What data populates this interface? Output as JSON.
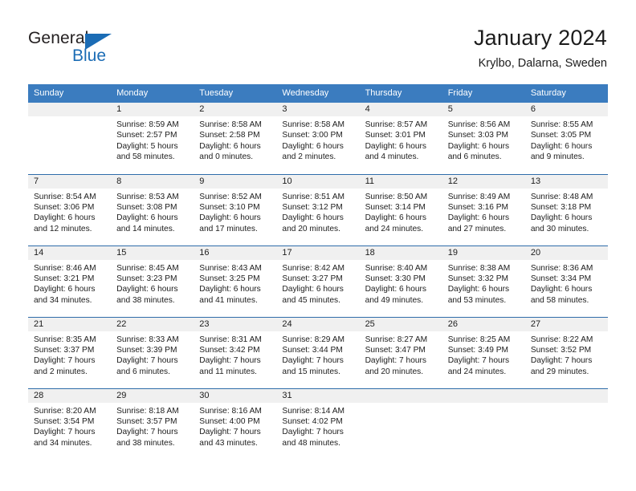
{
  "brand": {
    "name_part1": "General",
    "name_part2": "Blue",
    "flag_icon": "blue-triangle-flag"
  },
  "header": {
    "title": "January 2024",
    "subtitle": "Krylbo, Dalarna, Sweden"
  },
  "colors": {
    "header_blue": "#3b7cbf",
    "rule_blue": "#2f6daa",
    "brand_blue": "#1b6cb5",
    "daynum_band": "#f0f0f0",
    "text": "#1c1c1c"
  },
  "weekday_headers": [
    "Sunday",
    "Monday",
    "Tuesday",
    "Wednesday",
    "Thursday",
    "Friday",
    "Saturday"
  ],
  "weeks": [
    [
      {
        "day": "",
        "blank": true,
        "lines": []
      },
      {
        "day": "1",
        "lines": [
          "Sunrise: 8:59 AM",
          "Sunset: 2:57 PM",
          "Daylight: 5 hours",
          "and 58 minutes."
        ]
      },
      {
        "day": "2",
        "lines": [
          "Sunrise: 8:58 AM",
          "Sunset: 2:58 PM",
          "Daylight: 6 hours",
          "and 0 minutes."
        ]
      },
      {
        "day": "3",
        "lines": [
          "Sunrise: 8:58 AM",
          "Sunset: 3:00 PM",
          "Daylight: 6 hours",
          "and 2 minutes."
        ]
      },
      {
        "day": "4",
        "lines": [
          "Sunrise: 8:57 AM",
          "Sunset: 3:01 PM",
          "Daylight: 6 hours",
          "and 4 minutes."
        ]
      },
      {
        "day": "5",
        "lines": [
          "Sunrise: 8:56 AM",
          "Sunset: 3:03 PM",
          "Daylight: 6 hours",
          "and 6 minutes."
        ]
      },
      {
        "day": "6",
        "lines": [
          "Sunrise: 8:55 AM",
          "Sunset: 3:05 PM",
          "Daylight: 6 hours",
          "and 9 minutes."
        ]
      }
    ],
    [
      {
        "day": "7",
        "lines": [
          "Sunrise: 8:54 AM",
          "Sunset: 3:06 PM",
          "Daylight: 6 hours",
          "and 12 minutes."
        ]
      },
      {
        "day": "8",
        "lines": [
          "Sunrise: 8:53 AM",
          "Sunset: 3:08 PM",
          "Daylight: 6 hours",
          "and 14 minutes."
        ]
      },
      {
        "day": "9",
        "lines": [
          "Sunrise: 8:52 AM",
          "Sunset: 3:10 PM",
          "Daylight: 6 hours",
          "and 17 minutes."
        ]
      },
      {
        "day": "10",
        "lines": [
          "Sunrise: 8:51 AM",
          "Sunset: 3:12 PM",
          "Daylight: 6 hours",
          "and 20 minutes."
        ]
      },
      {
        "day": "11",
        "lines": [
          "Sunrise: 8:50 AM",
          "Sunset: 3:14 PM",
          "Daylight: 6 hours",
          "and 24 minutes."
        ]
      },
      {
        "day": "12",
        "lines": [
          "Sunrise: 8:49 AM",
          "Sunset: 3:16 PM",
          "Daylight: 6 hours",
          "and 27 minutes."
        ]
      },
      {
        "day": "13",
        "lines": [
          "Sunrise: 8:48 AM",
          "Sunset: 3:18 PM",
          "Daylight: 6 hours",
          "and 30 minutes."
        ]
      }
    ],
    [
      {
        "day": "14",
        "lines": [
          "Sunrise: 8:46 AM",
          "Sunset: 3:21 PM",
          "Daylight: 6 hours",
          "and 34 minutes."
        ]
      },
      {
        "day": "15",
        "lines": [
          "Sunrise: 8:45 AM",
          "Sunset: 3:23 PM",
          "Daylight: 6 hours",
          "and 38 minutes."
        ]
      },
      {
        "day": "16",
        "lines": [
          "Sunrise: 8:43 AM",
          "Sunset: 3:25 PM",
          "Daylight: 6 hours",
          "and 41 minutes."
        ]
      },
      {
        "day": "17",
        "lines": [
          "Sunrise: 8:42 AM",
          "Sunset: 3:27 PM",
          "Daylight: 6 hours",
          "and 45 minutes."
        ]
      },
      {
        "day": "18",
        "lines": [
          "Sunrise: 8:40 AM",
          "Sunset: 3:30 PM",
          "Daylight: 6 hours",
          "and 49 minutes."
        ]
      },
      {
        "day": "19",
        "lines": [
          "Sunrise: 8:38 AM",
          "Sunset: 3:32 PM",
          "Daylight: 6 hours",
          "and 53 minutes."
        ]
      },
      {
        "day": "20",
        "lines": [
          "Sunrise: 8:36 AM",
          "Sunset: 3:34 PM",
          "Daylight: 6 hours",
          "and 58 minutes."
        ]
      }
    ],
    [
      {
        "day": "21",
        "lines": [
          "Sunrise: 8:35 AM",
          "Sunset: 3:37 PM",
          "Daylight: 7 hours",
          "and 2 minutes."
        ]
      },
      {
        "day": "22",
        "lines": [
          "Sunrise: 8:33 AM",
          "Sunset: 3:39 PM",
          "Daylight: 7 hours",
          "and 6 minutes."
        ]
      },
      {
        "day": "23",
        "lines": [
          "Sunrise: 8:31 AM",
          "Sunset: 3:42 PM",
          "Daylight: 7 hours",
          "and 11 minutes."
        ]
      },
      {
        "day": "24",
        "lines": [
          "Sunrise: 8:29 AM",
          "Sunset: 3:44 PM",
          "Daylight: 7 hours",
          "and 15 minutes."
        ]
      },
      {
        "day": "25",
        "lines": [
          "Sunrise: 8:27 AM",
          "Sunset: 3:47 PM",
          "Daylight: 7 hours",
          "and 20 minutes."
        ]
      },
      {
        "day": "26",
        "lines": [
          "Sunrise: 8:25 AM",
          "Sunset: 3:49 PM",
          "Daylight: 7 hours",
          "and 24 minutes."
        ]
      },
      {
        "day": "27",
        "lines": [
          "Sunrise: 8:22 AM",
          "Sunset: 3:52 PM",
          "Daylight: 7 hours",
          "and 29 minutes."
        ]
      }
    ],
    [
      {
        "day": "28",
        "lines": [
          "Sunrise: 8:20 AM",
          "Sunset: 3:54 PM",
          "Daylight: 7 hours",
          "and 34 minutes."
        ]
      },
      {
        "day": "29",
        "lines": [
          "Sunrise: 8:18 AM",
          "Sunset: 3:57 PM",
          "Daylight: 7 hours",
          "and 38 minutes."
        ]
      },
      {
        "day": "30",
        "lines": [
          "Sunrise: 8:16 AM",
          "Sunset: 4:00 PM",
          "Daylight: 7 hours",
          "and 43 minutes."
        ]
      },
      {
        "day": "31",
        "lines": [
          "Sunrise: 8:14 AM",
          "Sunset: 4:02 PM",
          "Daylight: 7 hours",
          "and 48 minutes."
        ]
      },
      {
        "day": "",
        "blank": true,
        "lines": []
      },
      {
        "day": "",
        "blank": true,
        "lines": []
      },
      {
        "day": "",
        "blank": true,
        "lines": []
      }
    ]
  ]
}
